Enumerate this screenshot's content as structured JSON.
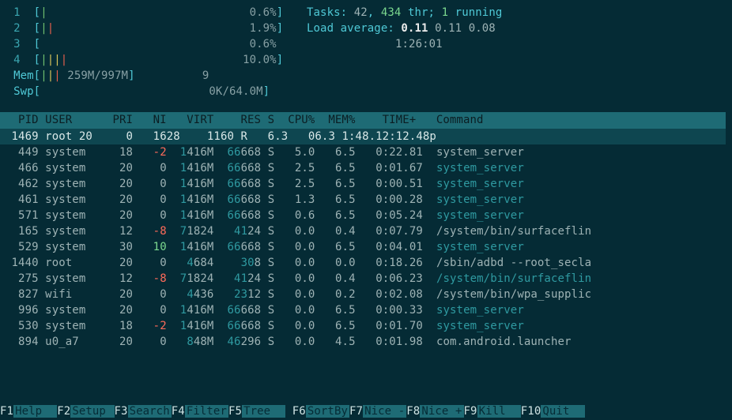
{
  "cpu_bars": [
    {
      "idx": "1",
      "bars": "|",
      "val": "0.6%"
    },
    {
      "idx": "2",
      "bars": "||",
      "val": "1.9%"
    },
    {
      "idx": "3",
      "bars": "",
      "val": "0.6%",
      "no_close": true
    },
    {
      "idx": "4",
      "bars": "||||",
      "val": "10.0%"
    }
  ],
  "mem": {
    "label": "Mem",
    "bars": "|||",
    "text": " 259M/997M",
    "extra": "9"
  },
  "swp": {
    "label": "Swp",
    "text": "0K/64.0M"
  },
  "tasks": {
    "label": "Tasks: ",
    "a": "42",
    "sep": ", ",
    "b": "434",
    "tail": " thr; ",
    "r": "1",
    "tail2": " running"
  },
  "load": {
    "label": "Load average: ",
    "a": "0.11",
    "b": "0.11",
    "c": "0.08"
  },
  "uptime": "1:26:01",
  "head": [
    "  PID",
    " USER   ",
    "  PRI",
    "  NI",
    "  VIRT",
    "   RES",
    " S",
    " CPU%",
    " MEM%",
    "   TIME+ ",
    " Command"
  ],
  "selected": {
    "pid": "1469",
    "user": "root 20",
    "pri": "0",
    "ni": "1628",
    "virt": "1160",
    "res": "",
    "s": "R",
    "cpu": "6.3",
    "mem": "06.3",
    "time": "1:48.12:12.48",
    "cmd": "p"
  },
  "rows": [
    {
      "pid": "449",
      "user": "system",
      "pri": "18",
      "ni": "-2",
      "virt": "1416M",
      "res": "66668",
      "s": "S",
      "cpu": "5.0",
      "mem": "6.5",
      "time": "0:22.81",
      "cmd": "system_server",
      "cmdcolor": "white"
    },
    {
      "pid": "466",
      "user": "system",
      "pri": "20",
      "ni": "0",
      "virt": "1416M",
      "res": "66668",
      "s": "S",
      "cpu": "2.5",
      "mem": "6.5",
      "time": "0:01.67",
      "cmd": "system_server",
      "cmdcolor": "teal"
    },
    {
      "pid": "462",
      "user": "system",
      "pri": "20",
      "ni": "0",
      "virt": "1416M",
      "res": "66668",
      "s": "S",
      "cpu": "2.5",
      "mem": "6.5",
      "time": "0:00.51",
      "cmd": "system_server",
      "cmdcolor": "teal"
    },
    {
      "pid": "461",
      "user": "system",
      "pri": "20",
      "ni": "0",
      "virt": "1416M",
      "res": "66668",
      "s": "S",
      "cpu": "1.3",
      "mem": "6.5",
      "time": "0:00.28",
      "cmd": "system_server",
      "cmdcolor": "teal"
    },
    {
      "pid": "571",
      "user": "system",
      "pri": "20",
      "ni": "0",
      "virt": "1416M",
      "res": "66668",
      "s": "S",
      "cpu": "0.6",
      "mem": "6.5",
      "time": "0:05.24",
      "cmd": "system_server",
      "cmdcolor": "teal"
    },
    {
      "pid": "165",
      "user": "system",
      "pri": "12",
      "ni": "-8",
      "virt": "71824",
      "res": "4124",
      "s": "S",
      "cpu": "0.0",
      "mem": "0.4",
      "time": "0:07.79",
      "cmd": "/system/bin/surfaceflin",
      "cmdcolor": "white"
    },
    {
      "pid": "529",
      "user": "system",
      "pri": "30",
      "ni": "10",
      "virt": "1416M",
      "res": "66668",
      "s": "S",
      "cpu": "0.0",
      "mem": "6.5",
      "time": "0:04.01",
      "cmd": "system_server",
      "cmdcolor": "teal"
    },
    {
      "pid": "1440",
      "user": "root",
      "pri": "20",
      "ni": "0",
      "virt": "4684",
      "res": "308",
      "s": "S",
      "cpu": "0.0",
      "mem": "0.0",
      "time": "0:18.26",
      "cmd": "/sbin/adbd --root_secla",
      "cmdcolor": "white"
    },
    {
      "pid": "275",
      "user": "system",
      "pri": "12",
      "ni": "-8",
      "virt": "71824",
      "res": "4124",
      "s": "S",
      "cpu": "0.0",
      "mem": "0.4",
      "time": "0:06.23",
      "cmd": "/system/bin/surfaceflin",
      "cmdcolor": "teal"
    },
    {
      "pid": "827",
      "user": "wifi",
      "pri": "20",
      "ni": "0",
      "virt": "4436",
      "res": "2312",
      "s": "S",
      "cpu": "0.0",
      "mem": "0.2",
      "time": "0:02.08",
      "cmd": "/system/bin/wpa_supplic",
      "cmdcolor": "white"
    },
    {
      "pid": "996",
      "user": "system",
      "pri": "20",
      "ni": "0",
      "virt": "1416M",
      "res": "66668",
      "s": "S",
      "cpu": "0.0",
      "mem": "6.5",
      "time": "0:00.33",
      "cmd": "system_server",
      "cmdcolor": "teal"
    },
    {
      "pid": "530",
      "user": "system",
      "pri": "18",
      "ni": "-2",
      "virt": "1416M",
      "res": "66668",
      "s": "S",
      "cpu": "0.0",
      "mem": "6.5",
      "time": "0:01.70",
      "cmd": "system_server",
      "cmdcolor": "teal"
    },
    {
      "pid": "894",
      "user": "u0_a7",
      "pri": "20",
      "ni": "0",
      "virt": "848M",
      "res": "46296",
      "s": "S",
      "cpu": "0.0",
      "mem": "4.5",
      "time": "0:01.98",
      "cmd": "com.android.launcher",
      "cmdcolor": "white"
    }
  ],
  "fkeys": [
    {
      "k": "F1",
      "l": "Help  "
    },
    {
      "k": "F2",
      "l": "Setup "
    },
    {
      "k": "F3",
      "l": "Search"
    },
    {
      "k": "F4",
      "l": "Filter"
    },
    {
      "k": "F5",
      "l": "Tree  "
    },
    {
      "k": "F6",
      "l": "SortBy"
    },
    {
      "k": "F7",
      "l": "Nice -"
    },
    {
      "k": "F8",
      "l": "Nice +"
    },
    {
      "k": "F9",
      "l": "Kill  "
    },
    {
      "k": "F10",
      "l": "Quit  "
    }
  ]
}
